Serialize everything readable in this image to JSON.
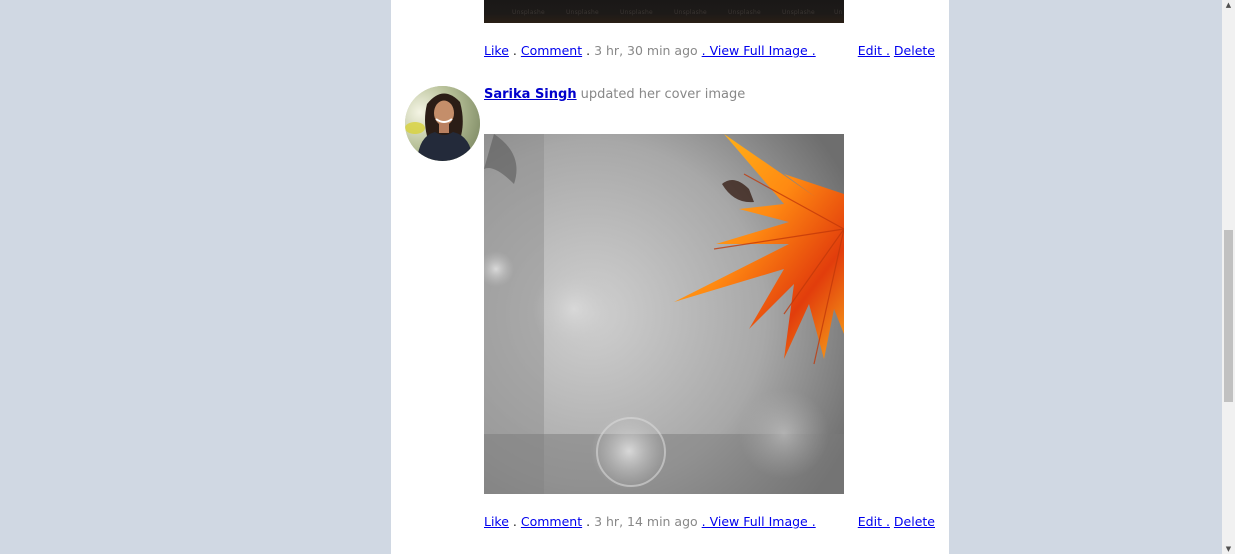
{
  "posts": [
    {
      "actions": {
        "like": "Like",
        "sep1": ".",
        "comment": "Comment",
        "sep2": ".",
        "time": "3 hr, 30 min ago",
        "view_full": ". View Full Image .",
        "edit": "Edit .",
        "delete": "Delete"
      }
    },
    {
      "author": "Sarika Singh",
      "activity": "updated her cover image",
      "actions": {
        "like": "Like",
        "sep1": ".",
        "comment": "Comment",
        "sep2": ".",
        "time": "3 hr, 14 min ago",
        "view_full": ". View Full Image .",
        "edit": "Edit .",
        "delete": "Delete"
      }
    }
  ],
  "colors": {
    "page_background": "#d0d8e3",
    "link": "#0000ee",
    "muted_text": "#888888"
  }
}
